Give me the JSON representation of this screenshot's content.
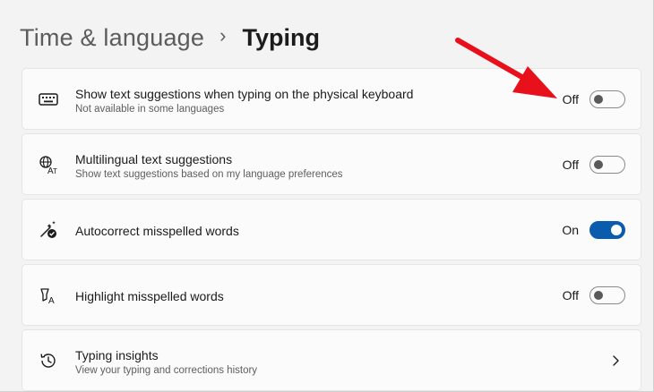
{
  "breadcrumb": {
    "parent": "Time & language",
    "separator": "›",
    "current": "Typing"
  },
  "settings": [
    {
      "icon": "keyboard-icon",
      "title": "Show text suggestions when typing on the physical keyboard",
      "subtitle": "Not available in some languages",
      "state_label": "Off",
      "on": false
    },
    {
      "icon": "multilingual-icon",
      "title": "Multilingual text suggestions",
      "subtitle": "Show text suggestions based on my language preferences",
      "state_label": "Off",
      "on": false
    },
    {
      "icon": "autocorrect-icon",
      "title": "Autocorrect misspelled words",
      "state_label": "On",
      "on": true
    },
    {
      "icon": "highlight-spelling-icon",
      "title": "Highlight misspelled words",
      "state_label": "Off",
      "on": false
    },
    {
      "icon": "history-icon",
      "title": "Typing insights",
      "subtitle": "View your typing and corrections history",
      "nav": "chevron-right-icon"
    }
  ],
  "colors": {
    "accent": "#0b5cad",
    "annotation_arrow": "#e8101a"
  }
}
